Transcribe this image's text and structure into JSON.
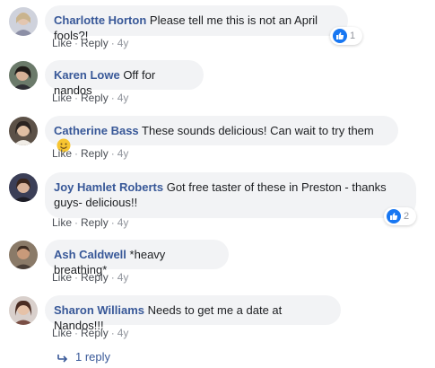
{
  "comments": [
    {
      "name": "Charlotte Horton",
      "text": "Please tell me this is not an April fools?!",
      "actions": {
        "like": "Like",
        "reply": "Reply",
        "time": "4y"
      },
      "reaction_count": "1"
    },
    {
      "name": "Karen Lowe",
      "text": "Off for nandos",
      "actions": {
        "like": "Like",
        "reply": "Reply",
        "time": "4y"
      }
    },
    {
      "name": "Catherine Bass",
      "text": "These sounds delicious! Can wait to try them",
      "actions": {
        "like": "Like",
        "reply": "Reply",
        "time": "4y"
      }
    },
    {
      "name": "Joy Hamlet Roberts",
      "text": "Got free taster of these in Preston - thanks guys- delicious!!",
      "actions": {
        "like": "Like",
        "reply": "Reply",
        "time": "4y"
      },
      "reaction_count": "2"
    },
    {
      "name": "Ash Caldwell",
      "text": "*heavy breathing*",
      "actions": {
        "like": "Like",
        "reply": "Reply",
        "time": "4y"
      }
    },
    {
      "name": "Sharon Williams",
      "text": "Needs to get me a date at Nandos!!!",
      "actions": {
        "like": "Like",
        "reply": "Reply",
        "time": "4y"
      }
    }
  ],
  "replies_link": "1 reply",
  "colors": {
    "name": "#385898",
    "bubble": "#f2f3f5",
    "meta": "#90949c",
    "like_badge": "#1877f2"
  },
  "icons": {
    "reaction": "thumbs-up-icon",
    "emoji": "smiling-face-icon",
    "reply": "reply-arrow-icon"
  }
}
